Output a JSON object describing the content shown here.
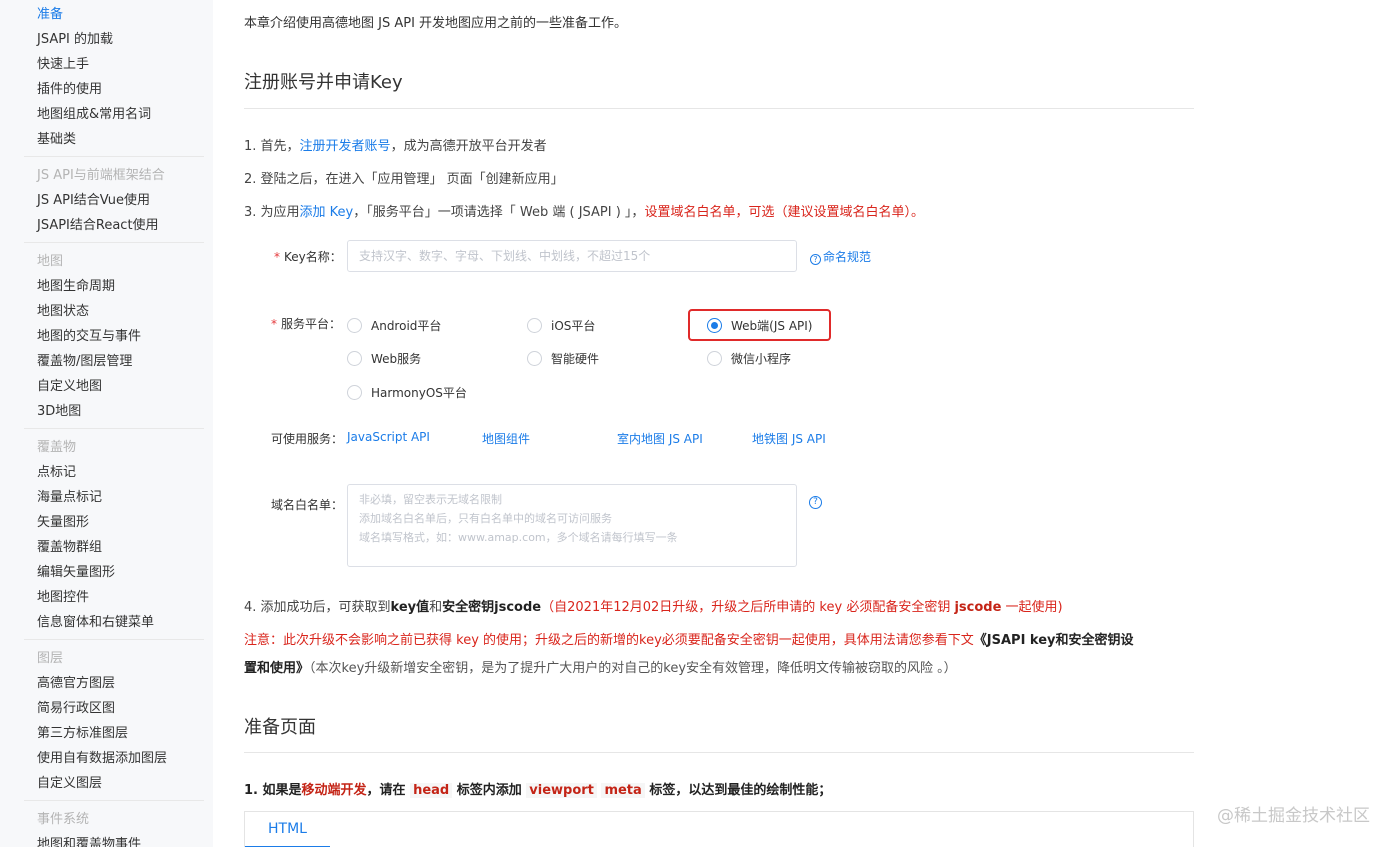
{
  "sidebar": {
    "groups": [
      {
        "title": "",
        "items": [
          "准备",
          "JSAPI 的加载",
          "快速上手",
          "插件的使用",
          "地图组成&常用名词",
          "基础类"
        ]
      },
      {
        "title": "JS API与前端框架结合",
        "items": [
          "JS API结合Vue使用",
          "JSAPI结合React使用"
        ]
      },
      {
        "title": "地图",
        "items": [
          "地图生命周期",
          "地图状态",
          "地图的交互与事件",
          "覆盖物/图层管理",
          "自定义地图",
          "3D地图"
        ]
      },
      {
        "title": "覆盖物",
        "items": [
          "点标记",
          "海量点标记",
          "矢量图形",
          "覆盖物群组",
          "编辑矢量图形",
          "地图控件",
          "信息窗体和右键菜单"
        ]
      },
      {
        "title": "图层",
        "items": [
          "高德官方图层",
          "简易行政区图",
          "第三方标准图层",
          "使用自有数据添加图层",
          "自定义图层"
        ]
      },
      {
        "title": "事件系统",
        "items": [
          "地图和覆盖物事件"
        ]
      }
    ]
  },
  "main": {
    "intro": "本章介绍使用高德地图 JS API 开发地图应用之前的一些准备工作。",
    "section1_title": "注册账号并申请Key",
    "step1": {
      "prefix": "1. 首先，",
      "link": "注册开发者账号",
      "suffix": "，成为高德开放平台开发者"
    },
    "step2": "2. 登陆之后，在进入「应用管理」 页面「创建新应用」",
    "step3": {
      "prefix": "3. 为应用",
      "link": "添加 Key",
      "middle": "，「服务平台」一项请选择「 Web 端 ( JSAPI ) 」，",
      "red": "设置域名白名单，可选（建议设置域名白名单）。"
    },
    "form": {
      "key_label": "Key名称：",
      "key_placeholder": "支持汉字、数字、字母、下划线、中划线，不超过15个",
      "naming_rule": "命名规范",
      "platform_label": "服务平台：",
      "platforms": [
        "Android平台",
        "iOS平台",
        "Web端(JS API)",
        "Web服务",
        "智能硬件",
        "微信小程序",
        "HarmonyOS平台"
      ],
      "services_label": "可使用服务：",
      "services": [
        "JavaScript API",
        "地图组件",
        "室内地图 JS API",
        "地铁图 JS API"
      ],
      "domain_label": "域名白名单：",
      "domain_placeholder": "非必填，留空表示无域名限制\n添加域名白名单后，只有白名单中的域名可访问服务\n域名填写格式，如：www.amap.com，多个域名请每行填写一条",
      "help_mark": "?",
      "star": "*"
    },
    "step4": {
      "prefix": "4. 添加成功后，可获取到",
      "b1": "key值",
      "mid": "和",
      "b2": "安全密钥jscode",
      "red_pre": "（自2021年12月02日升级，升级之后所申请的 key 必须配备安全密钥 ",
      "red_bold": "jscode",
      "red_post": " 一起使用)"
    },
    "notice_line1": {
      "text": "注意：此次升级不会影响之前已获得 key 的使用；升级之后的新增的key必须要配备安全密钥一起使用，具体用法请您参看下文",
      "bold": "《JSAPI key和安全密钥设"
    },
    "notice_line2": {
      "bold": "置和使用》",
      "gray": "（本次key升级新增安全密钥，是为了提升广大用户的对自己的key安全有效管理，降低明文传输被窃取的风险 。）"
    },
    "section2_title": "准备页面",
    "prep1": {
      "prefix": "1. 如果是",
      "red1": "移动端开发",
      "mid1": "，请在 ",
      "tag1": "head",
      "mid2": " 标签内添加 ",
      "tag2": "viewport",
      "mid3": " ",
      "tag3": "meta",
      "suffix": " 标签，以达到最佳的绘制性能；"
    },
    "code_tab": "HTML"
  },
  "watermark": "@稀土掘金技术社区"
}
